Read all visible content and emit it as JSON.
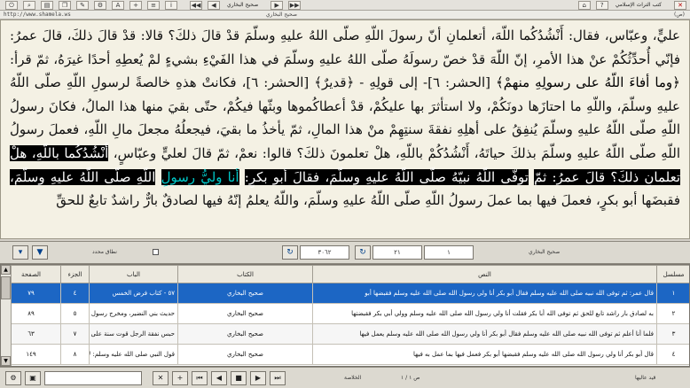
{
  "toolbar": {
    "title": "صحيح البخاري",
    "right_title": "كتب التراث الإسلامي",
    "close_glyph": "✕"
  },
  "addressbar": {
    "url": "http://www.shamela.ws",
    "center_text": "صحيح البخاري",
    "right_text": "(ص)"
  },
  "reader": {
    "line1": "عليٍّ، وعبّاس، فقال: أَنْشُدُكُما اللّهَ، أتعلمانِ أنّ رسولَ اللّهِ صلّى اللهُ عليهِ وسلّمَ قدْ قالَ ذلكَ؟ قالا: قدْ قالَ ذلكَ، قالَ عمرُ: فإنّي",
    "line2": "أُحدِّثُكُمْ عنْ هذا الأمرِ، إنّ اللّهَ قدْ خصّ رسولَهُ صلّى اللهُ عليهِ وسلّمَ في هذا الفَيْءِ بشيءٍ لمْ يُعطِهِ أحدًا غيرَهُ، ثمّ قرأ:",
    "quran": "﴿وما أفاءَ اللّهُ على رسولِهِ منهمْ﴾",
    "line3": "[الحشر: ٦]- إلى قولِهِ - ﴿قديرٌ﴾ [الحشر: ٦]، فكانتْ هذهِ خالصةً لرسولِ اللّهِ صلّى اللّهُ عليهِ وسلّمَ، واللّهِ",
    "line4": "ما احتازَها دونَكُمْ، ولا استأثرَ بها عليكُمْ، قدْ أعطاكُموها وبثّها فيكُمْ، حتّى بقيَ منها هذا المالُ، فكانَ رسولُ اللّهِ صلّى اللّهُ عليهِ",
    "line5": "وسلّمَ يُنفِقُ على أهلِهِ نفقةَ سنتِهِمْ منْ هذا المالِ، ثمّ يأخذُ ما بقيَ، فيجعلُهُ مجعلَ مالِ اللّهِ، فعملَ رسولُ اللّهِ صلّى اللّهُ عليهِ وسلّمَ",
    "line6a": "بذلكَ حياتَهُ، أَنْشُدُكُمْ باللّهِ، هلْ تعلمونَ ذلكَ؟ قالوا: نعمْ، ثمّ قالَ لعليٍّ وعبّاسٍ،",
    "line6b": "أَنْشُدُكُما باللّهِ، هلْ تعلمانِ ذلكَ؟ قالَ عمرُ: ثمّ",
    "line7a": "توفّى اللّهُ نبيّهُ صلّى اللّهُ عليهِ وسلّمَ، فقالَ أبو بكرٍ:",
    "line7b": "أنا وليُّ رسولِ",
    "line7c": "اللّهِ صلّى اللّهُ عليهِ وسلّمَ،",
    "line7d": "فقبضَها أبو بكرٍ، فعملَ فيها بما عملَ",
    "line8": "رسولُ اللّهِ صلّى اللّهُ عليهِ وسلّمَ، واللّهُ يعلمُ إنّهُ فيها لصادقٌ بارٌّ راشدٌ تابعٌ للحقِّ"
  },
  "controls": {
    "book_label": "صحيح البخاري",
    "field1": "٢١",
    "field2": "١",
    "field3": "٣٠٦٢",
    "checkbox_label": "نطاق محدد"
  },
  "grid": {
    "headers": {
      "serial": "مسلسل",
      "text": "النص",
      "book": "الكتاب",
      "chapter": "الباب",
      "part": "الجزء",
      "page": "الصفحة"
    },
    "rows": [
      {
        "serial": "١",
        "text": "قال عمر: ثم توفى الله نبيه صلى الله عليه وسلم فقال أبو بكر أنا ولي رسول الله صلى الله عليه وسلم فقبضها أبو",
        "book": "صحيح البخاري",
        "chapter": "٥٧ - كتاب فرض الخمس",
        "part": "٤",
        "page": "٧٩"
      },
      {
        "serial": "٢",
        "text": "به لصادق بار راشد تابع للحق ثم توفى الله أبا بكر فقلت أنا ولي رسول الله صلى الله عليه وسلم وولي أبي بكر فقبضتها",
        "book": "صحيح البخاري",
        "chapter": "حديث بني النضير، ومخرج رسول الله",
        "part": "٥",
        "page": "٨٩"
      },
      {
        "serial": "٣",
        "text": "فلما أنا أعلم ثم توفى الله نبيه صلى الله عليه وسلم فقال أبو بكر أنا ولي رسول الله صلى الله عليه وسلم يعمل فيها",
        "book": "صحيح البخاري",
        "chapter": "حبس نفقة الرجل قوت سنة على أهله",
        "part": "٧",
        "page": "٦٣"
      },
      {
        "serial": "٤",
        "text": "قال أبو بكر أنا ولي رسول الله صلى الله عليه وسلم فقبضها أبو بكر فعمل فيها بما عمل به فيها",
        "book": "صحيح البخاري",
        "chapter": "قول النبي صلى الله عليه وسلم: لا نو",
        "part": "٨",
        "page": "١٤٩"
      }
    ]
  },
  "bottombar": {
    "page_label": "ص ١ / ١",
    "right_label": "قيد عاليها",
    "field_label": "الخلاصة"
  }
}
